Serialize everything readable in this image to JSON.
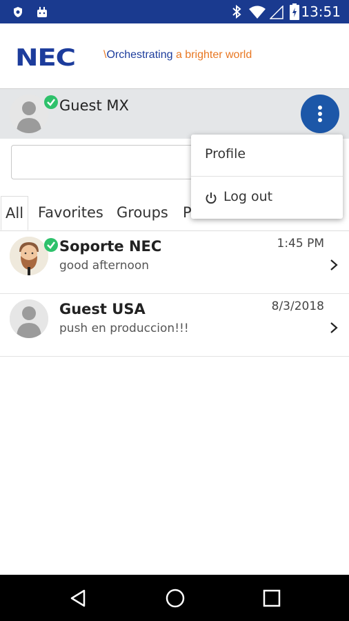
{
  "status_bar": {
    "time": "13:51",
    "icons": [
      "shield-icon",
      "android-icon",
      "bluetooth-icon",
      "wifi-icon",
      "signal-icon",
      "battery-charging-icon"
    ]
  },
  "header": {
    "logo": "NEC",
    "tagline_part1": "Orchestrating",
    "tagline_part2": "a brighter world"
  },
  "user": {
    "name": "Guest MX",
    "status": "online"
  },
  "search": {
    "value": "",
    "placeholder": ""
  },
  "tabs": [
    {
      "label": "All"
    },
    {
      "label": "Favorites"
    },
    {
      "label": "Groups"
    },
    {
      "label": "P"
    }
  ],
  "menu": {
    "profile_label": "Profile",
    "logout_label": "Log out"
  },
  "conversations": [
    {
      "name": "Soporte NEC",
      "message": "good afternoon",
      "time": "1:45 PM",
      "presence": "online"
    },
    {
      "name": "Guest USA",
      "message": "push en produccion!!!",
      "time": "8/3/2018",
      "presence": "none"
    }
  ],
  "colors": {
    "status_bar": "#1a3a8f",
    "brand_blue": "#1c3c9c",
    "brand_orange": "#e87722",
    "presence_green": "#2ec16b",
    "menu_button": "#1c57a8"
  }
}
